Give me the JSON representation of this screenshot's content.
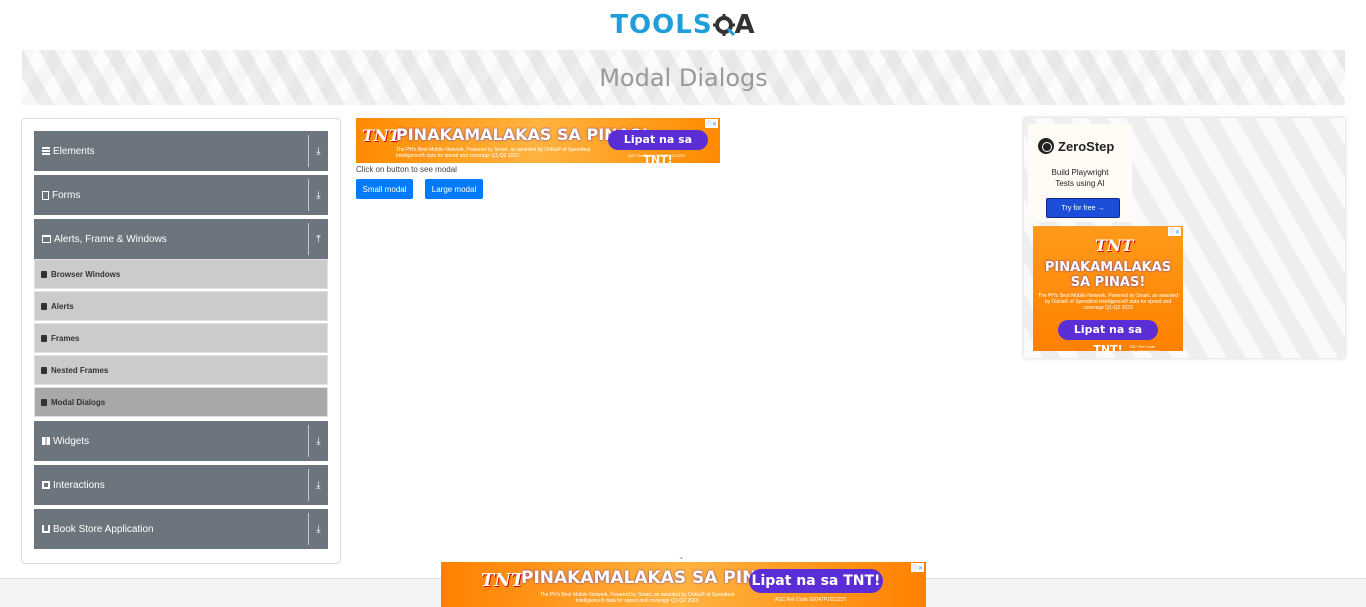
{
  "logo": {
    "part1": "TOOLS",
    "part2": "QA"
  },
  "page_title": "Modal Dialogs",
  "sidebar": {
    "groups": [
      {
        "label": "Elements",
        "icon": "list-icon",
        "expanded": false
      },
      {
        "label": "Forms",
        "icon": "form-icon",
        "expanded": false
      },
      {
        "label": "Alerts, Frame & Windows",
        "icon": "window-icon",
        "expanded": true,
        "items": [
          "Browser Windows",
          "Alerts",
          "Frames",
          "Nested Frames",
          "Modal Dialogs"
        ],
        "active": "Modal Dialogs"
      },
      {
        "label": "Widgets",
        "icon": "widgets-icon",
        "expanded": false
      },
      {
        "label": "Interactions",
        "icon": "interactions-icon",
        "expanded": false
      },
      {
        "label": "Book Store Application",
        "icon": "bookstore-icon",
        "expanded": false
      }
    ]
  },
  "main": {
    "instruction": "Click on button to see modal",
    "small_modal_label": "Small modal",
    "large_modal_label": "Large modal"
  },
  "ads": {
    "tnt_logo": "TNT",
    "headline": "PINAKAMALAKAS SA PINAS!",
    "headline_line1": "PINAKAMALAKAS",
    "headline_line2": "SA PINAS!",
    "cta": "Lipat na sa TNT!",
    "fine_print": "The PH's Best Mobile Network, Powered by Smart, as awarded by Ookla® of Speedtest Intelligence® data for speed and coverage Q1-Q2 2023",
    "ref": "ASC Ref Code S0047P101323T"
  },
  "zerostep": {
    "brand": "ZeroStep",
    "tagline_line1": "Build Playwright",
    "tagline_line2": "Tests using AI",
    "cta": "Try for free →"
  },
  "colors": {
    "primary_button": "#007bff",
    "sidebar_header": "#6c757d",
    "logo_blue": "#1f9fd9"
  }
}
